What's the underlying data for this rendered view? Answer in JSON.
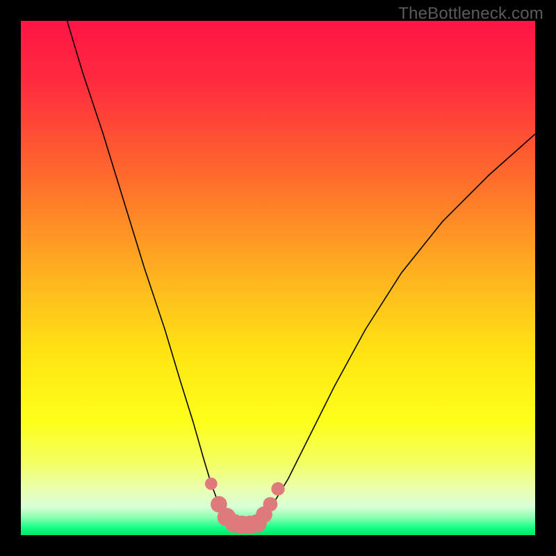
{
  "watermark": "TheBottleneck.com",
  "chart_data": {
    "type": "line",
    "title": "",
    "xlabel": "",
    "ylabel": "",
    "xlim": [
      0,
      100
    ],
    "ylim": [
      0,
      100
    ],
    "series": [
      {
        "name": "bottleneck-curve",
        "x": [
          9,
          12,
          16,
          20,
          24,
          28,
          31,
          33.5,
          35.5,
          37,
          38.5,
          40,
          41.5,
          43,
          44.5,
          46,
          47,
          49,
          52,
          56,
          61,
          67,
          74,
          82,
          91,
          100
        ],
        "y": [
          100,
          90,
          78,
          65,
          52,
          40,
          30,
          22,
          15,
          10,
          6,
          3.5,
          2.3,
          2.0,
          2.0,
          2.3,
          3.5,
          6,
          11,
          19,
          29,
          40,
          51,
          61,
          70,
          78
        ]
      }
    ],
    "markers": {
      "name": "highlight-dots",
      "color": "#df7a7a",
      "points": [
        {
          "x": 37.0,
          "y": 10.0,
          "r": 1.2
        },
        {
          "x": 38.5,
          "y": 6.0,
          "r": 1.6
        },
        {
          "x": 40.0,
          "y": 3.5,
          "r": 1.8
        },
        {
          "x": 41.5,
          "y": 2.3,
          "r": 1.8
        },
        {
          "x": 43.0,
          "y": 2.0,
          "r": 1.8
        },
        {
          "x": 44.5,
          "y": 2.0,
          "r": 1.8
        },
        {
          "x": 46.0,
          "y": 2.3,
          "r": 1.8
        },
        {
          "x": 47.3,
          "y": 4.0,
          "r": 1.6
        },
        {
          "x": 48.5,
          "y": 6.0,
          "r": 1.4
        },
        {
          "x": 50.0,
          "y": 9.0,
          "r": 1.3
        }
      ]
    },
    "gradient_stops": [
      {
        "offset": 0.0,
        "color": "#ff1545"
      },
      {
        "offset": 0.12,
        "color": "#ff2b3e"
      },
      {
        "offset": 0.3,
        "color": "#ff6a2c"
      },
      {
        "offset": 0.5,
        "color": "#ffb41f"
      },
      {
        "offset": 0.65,
        "color": "#ffe513"
      },
      {
        "offset": 0.78,
        "color": "#fdff1a"
      },
      {
        "offset": 0.86,
        "color": "#f3ff63"
      },
      {
        "offset": 0.91,
        "color": "#eaffb0"
      },
      {
        "offset": 0.945,
        "color": "#d8ffd6"
      },
      {
        "offset": 0.965,
        "color": "#8effb3"
      },
      {
        "offset": 0.985,
        "color": "#17ff87"
      },
      {
        "offset": 1.0,
        "color": "#00e46a"
      }
    ]
  }
}
